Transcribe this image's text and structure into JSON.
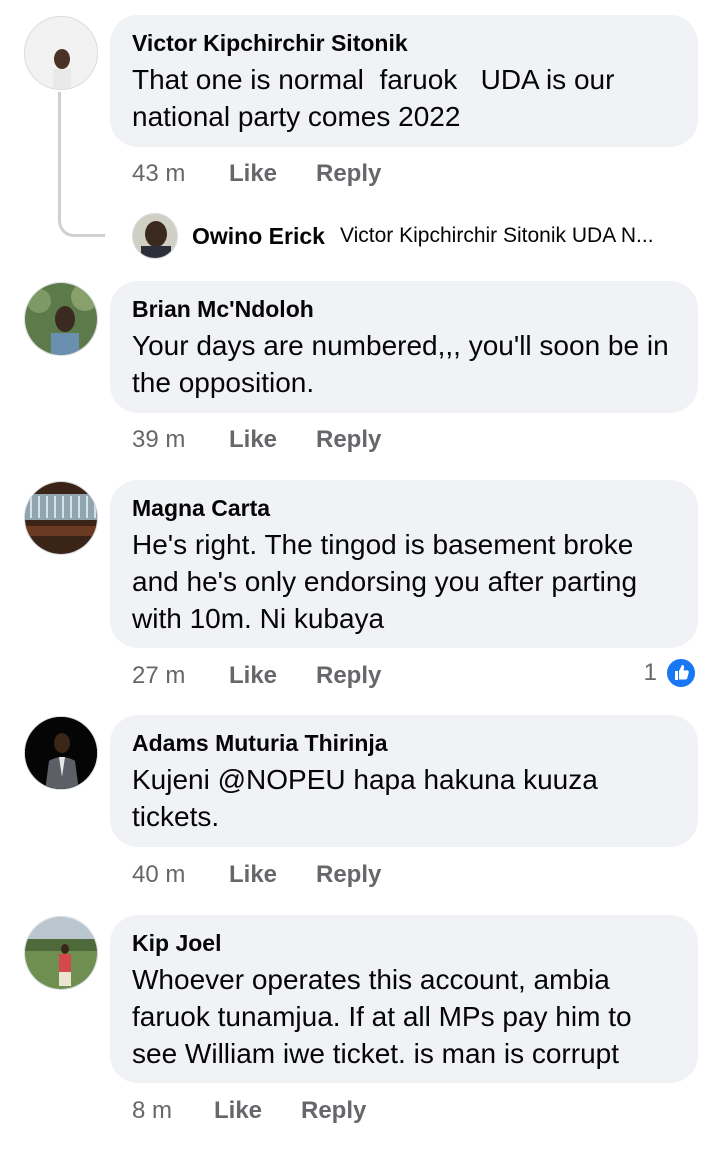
{
  "comments": [
    {
      "author": "Victor Kipchirchir Sitonik",
      "text": "That one is normal  faruok   UDA is our national party comes 2022",
      "time": "43 m",
      "like_label": "Like",
      "reply_label": "Reply",
      "reply_preview": {
        "author": "Owino Erick",
        "text": "Victor Kipchirchir Sitonik UDA N..."
      }
    },
    {
      "author": "Brian Mc'Ndoloh",
      "text": "Your days are numbered,,, you'll soon be in the opposition.",
      "time": "39 m",
      "like_label": "Like",
      "reply_label": "Reply"
    },
    {
      "author": "Magna Carta",
      "text": "He's right. The tingod is basement broke and he's only endorsing you after parting with 10m. Ni kubaya",
      "time": "27 m",
      "like_label": "Like",
      "reply_label": "Reply",
      "reaction_count": "1"
    },
    {
      "author": "Adams Muturia Thirinja",
      "text": "Kujeni @NOPEU hapa hakuna kuuza tickets.",
      "time": "40 m",
      "like_label": "Like",
      "reply_label": "Reply"
    },
    {
      "author": "Kip Joel",
      "text": "Whoever operates this account, ambia faruok tunamjua. If at all MPs pay him to see William iwe ticket. is man is corrupt",
      "time": "8 m",
      "like_label": "Like",
      "reply_label": "Reply"
    }
  ],
  "colors": {
    "bubble": "#f0f2f5",
    "meta_text": "#65676b",
    "like_blue": "#1877f2"
  },
  "icons": {
    "reaction": "like-reaction-icon"
  }
}
